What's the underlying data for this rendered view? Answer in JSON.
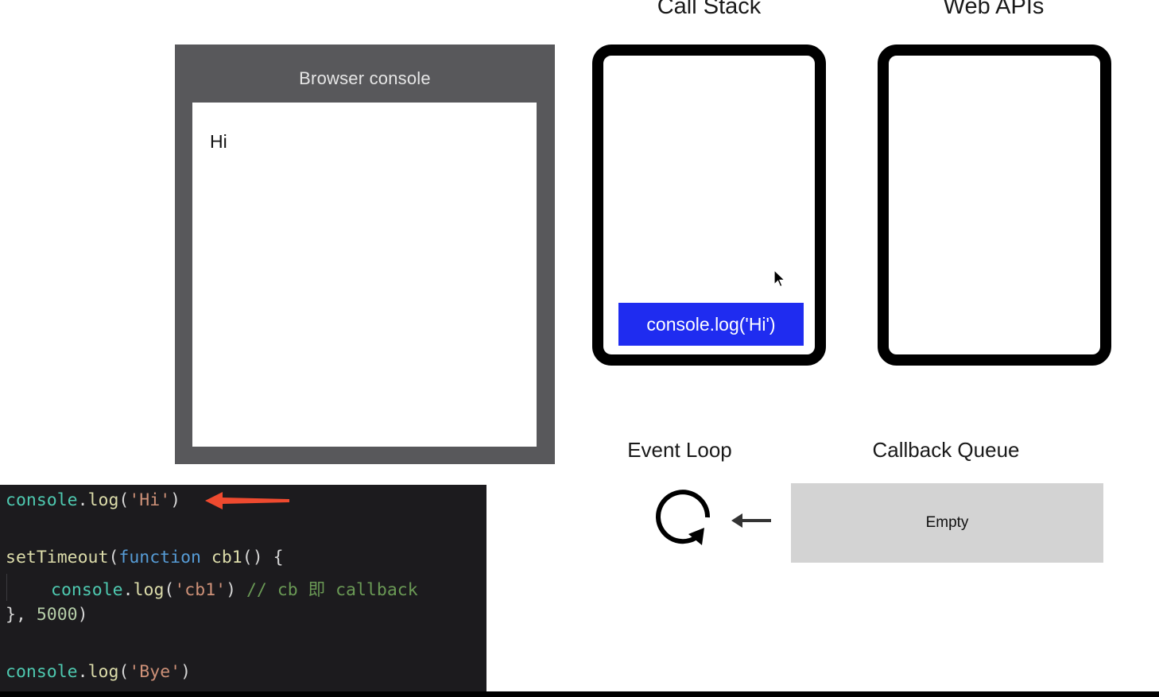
{
  "browser_console": {
    "title": "Browser console",
    "output": [
      "Hi"
    ]
  },
  "call_stack": {
    "heading": "Call Stack",
    "items": [
      "console.log('Hi')"
    ]
  },
  "web_apis": {
    "heading": "Web APIs"
  },
  "event_loop": {
    "heading": "Event Loop",
    "icon": "refresh-loop-icon"
  },
  "callback_queue": {
    "heading": "Callback Queue",
    "content": "Empty"
  },
  "code": {
    "line1": {
      "obj": "console",
      "dot": ".",
      "fn": "log",
      "open": "(",
      "str": "'Hi'",
      "close": ")"
    },
    "line3": {
      "fn": "setTimeout",
      "open": "(",
      "kw": "function",
      "name": " cb1",
      "rest": "() {"
    },
    "line4": {
      "obj": "console",
      "dot": ".",
      "fn": "log",
      "open": "(",
      "str": "'cb1'",
      "close": ")",
      "comment": " // cb 即 callback"
    },
    "line5": {
      "brace": "}, ",
      "num": "5000",
      "close": ")"
    },
    "line7": {
      "obj": "console",
      "dot": ".",
      "fn": "log",
      "open": "(",
      "str": "'Bye'",
      "close": ")"
    }
  },
  "colors": {
    "stack_item": "#1f2cf0",
    "pointer_arrow": "#ee4a2f",
    "console_frame": "#58585b",
    "queue_box": "#d3d3d3",
    "code_bg": "#1c1b1e"
  }
}
